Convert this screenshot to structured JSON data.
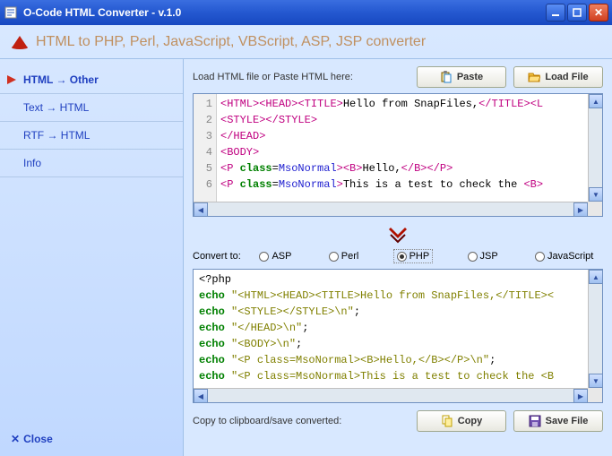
{
  "window": {
    "title": "O-Code HTML Converter - v.1.0"
  },
  "header": {
    "subtitle": "HTML to PHP, Perl, JavaScript, VBScript, ASP, JSP converter"
  },
  "sidebar": {
    "items": [
      {
        "label": "HTML → Other"
      },
      {
        "label": "Text → HTML"
      },
      {
        "label": "RTF → HTML"
      },
      {
        "label": "Info"
      }
    ],
    "close": "Close"
  },
  "main": {
    "load_label": "Load HTML file or Paste HTML here:",
    "paste_btn": "Paste",
    "loadfile_btn": "Load File",
    "convert_label": "Convert to:",
    "radios": [
      "ASP",
      "Perl",
      "PHP",
      "JSP",
      "JavaScript"
    ],
    "selected_radio": "PHP",
    "copy_label": "Copy to clipboard/save converted:",
    "copy_btn": "Copy",
    "savefile_btn": "Save File"
  },
  "source_lines": [
    "1",
    "2",
    "3",
    "4",
    "5",
    "6"
  ],
  "source_code": [
    [
      {
        "t": "tag",
        "v": "<HTML>"
      },
      {
        "t": "tag",
        "v": "<HEAD>"
      },
      {
        "t": "tag",
        "v": "<TITLE>"
      },
      {
        "t": "txt",
        "v": "Hello from SnapFiles,"
      },
      {
        "t": "tag",
        "v": "</TITLE>"
      },
      {
        "t": "tag",
        "v": "<L"
      }
    ],
    [
      {
        "t": "tag",
        "v": "<STYLE>"
      },
      {
        "t": "tag",
        "v": "</STYLE>"
      }
    ],
    [
      {
        "t": "tag",
        "v": "</HEAD>"
      }
    ],
    [
      {
        "t": "tag",
        "v": "<BODY>"
      }
    ],
    [
      {
        "t": "tag",
        "v": "<P "
      },
      {
        "t": "kw",
        "v": "class"
      },
      {
        "t": "txt",
        "v": "="
      },
      {
        "t": "val",
        "v": "MsoNormal"
      },
      {
        "t": "tag",
        "v": ">"
      },
      {
        "t": "tag",
        "v": "<B>"
      },
      {
        "t": "txt",
        "v": "Hello,"
      },
      {
        "t": "tag",
        "v": "</B>"
      },
      {
        "t": "tag",
        "v": "</P>"
      }
    ],
    [
      {
        "t": "tag",
        "v": "<P "
      },
      {
        "t": "kw",
        "v": "class"
      },
      {
        "t": "txt",
        "v": "="
      },
      {
        "t": "val",
        "v": "MsoNormal"
      },
      {
        "t": "tag",
        "v": ">"
      },
      {
        "t": "txt",
        "v": "This is a test to check the "
      },
      {
        "t": "tag",
        "v": "<B>"
      }
    ]
  ],
  "output_code": [
    [
      {
        "t": "txt",
        "v": "<?php"
      }
    ],
    [
      {
        "t": "kw",
        "v": "echo"
      },
      {
        "t": "txt",
        "v": " "
      },
      {
        "t": "str",
        "v": "\"<HTML><HEAD><TITLE>Hello from SnapFiles,</TITLE><"
      }
    ],
    [
      {
        "t": "kw",
        "v": "echo"
      },
      {
        "t": "txt",
        "v": " "
      },
      {
        "t": "str",
        "v": "\"<STYLE></STYLE>\\n\""
      },
      {
        "t": "txt",
        "v": ";"
      }
    ],
    [
      {
        "t": "kw",
        "v": "echo"
      },
      {
        "t": "txt",
        "v": " "
      },
      {
        "t": "str",
        "v": "\"</HEAD>\\n\""
      },
      {
        "t": "txt",
        "v": ";"
      }
    ],
    [
      {
        "t": "kw",
        "v": "echo"
      },
      {
        "t": "txt",
        "v": " "
      },
      {
        "t": "str",
        "v": "\"<BODY>\\n\""
      },
      {
        "t": "txt",
        "v": ";"
      }
    ],
    [
      {
        "t": "kw",
        "v": "echo"
      },
      {
        "t": "txt",
        "v": " "
      },
      {
        "t": "str",
        "v": "\"<P class=MsoNormal><B>Hello,</B></P>\\n\""
      },
      {
        "t": "txt",
        "v": ";"
      }
    ],
    [
      {
        "t": "kw",
        "v": "echo"
      },
      {
        "t": "txt",
        "v": " "
      },
      {
        "t": "str",
        "v": "\"<P class=MsoNormal>This is a test to check the <B"
      }
    ],
    [
      {
        "t": "txt",
        "v": "?>"
      }
    ]
  ]
}
